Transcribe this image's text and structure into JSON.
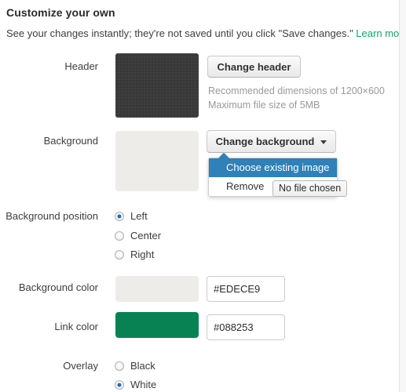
{
  "section": {
    "title": "Customize your own",
    "description_before": "See your changes instantly; they're not saved until you click \"Save changes.\" ",
    "learn_more": "Learn more."
  },
  "header_row": {
    "label": "Header",
    "button_label": "Change header",
    "hint_line_1": "Recommended dimensions of 1200×600",
    "hint_line_2": "Maximum file size of 5MB",
    "thumbnail_color": "#3b3b3b"
  },
  "background_row": {
    "label": "Background",
    "button_label": "Change background",
    "swatch_color": "#edece9",
    "dropdown": {
      "items": [
        {
          "label": "Choose existing image",
          "highlighted": true
        },
        {
          "label": "Remove",
          "highlighted": false
        }
      ],
      "highlight_color": "#2f81b7"
    },
    "file_chooser_label": "No file chosen"
  },
  "background_position": {
    "label": "Background position",
    "options": [
      {
        "label": "Left",
        "selected": true
      },
      {
        "label": "Center",
        "selected": false
      },
      {
        "label": "Right",
        "selected": false
      }
    ]
  },
  "background_color": {
    "label": "Background color",
    "value": "#EDECE9",
    "swatch_color": "#edece9"
  },
  "link_color": {
    "label": "Link color",
    "value": "#088253",
    "swatch_color": "#088253"
  },
  "overlay": {
    "label": "Overlay",
    "options": [
      {
        "label": "Black",
        "selected": false
      },
      {
        "label": "White",
        "selected": true
      }
    ]
  },
  "colors": {
    "link": "#14a06a",
    "accent_blue": "#2f81b7",
    "radio_dot": "#1c6fb8"
  }
}
